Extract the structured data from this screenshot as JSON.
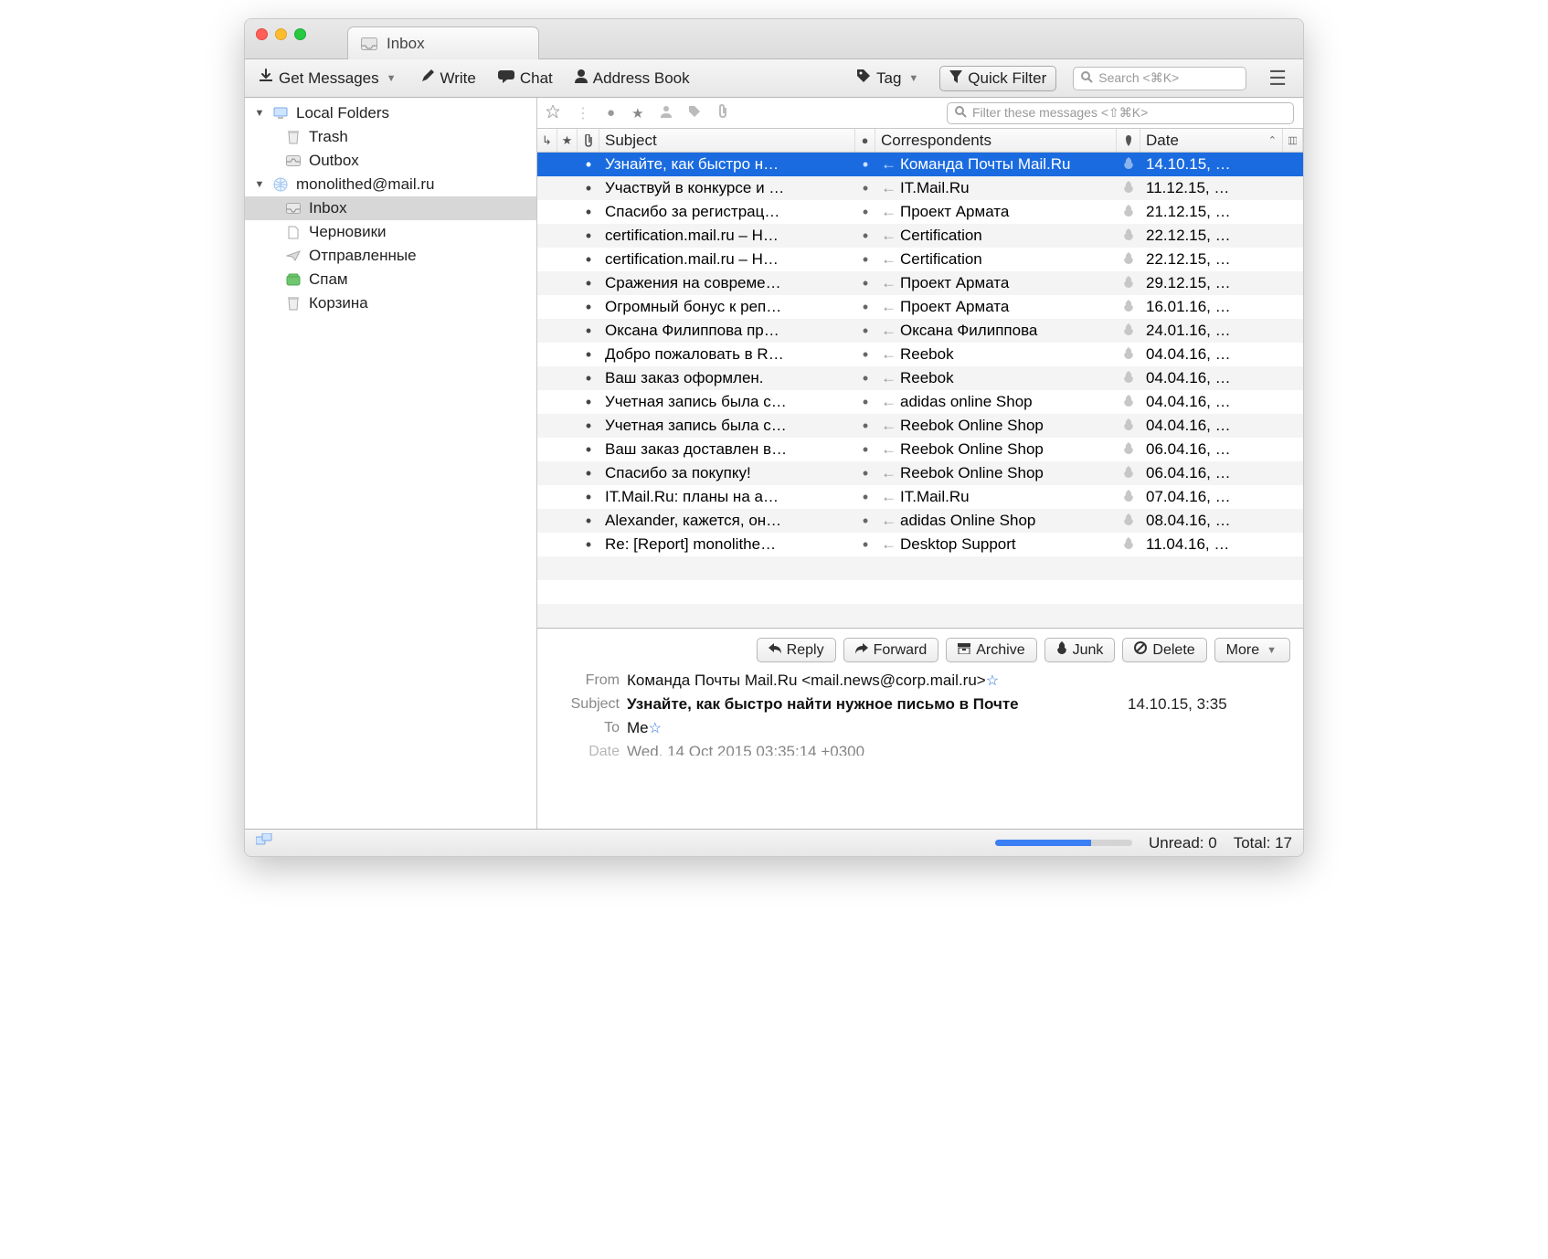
{
  "tab": {
    "title": "Inbox"
  },
  "toolbar": {
    "get_messages": "Get Messages",
    "write": "Write",
    "chat": "Chat",
    "address_book": "Address Book",
    "tag": "Tag",
    "quick_filter": "Quick Filter",
    "search_placeholder": "Search <⌘K>"
  },
  "sidebar": {
    "local": {
      "label": "Local Folders",
      "trash": "Trash",
      "outbox": "Outbox"
    },
    "account": {
      "email": "monolithed@mail.ru",
      "inbox": "Inbox",
      "drafts": "Черновики",
      "sent": "Отправленные",
      "spam": "Спам",
      "trash": "Корзина"
    }
  },
  "filter": {
    "placeholder": "Filter these messages <⇧⌘K>"
  },
  "columns": {
    "subject": "Subject",
    "correspondents": "Correspondents",
    "date": "Date"
  },
  "messages": [
    {
      "subject": "Узнайте, как быстро н…",
      "from": "Команда Почты Mail.Ru",
      "date": "14.10.15, …",
      "selected": true
    },
    {
      "subject": "Участвуй в конкурсе и …",
      "from": "IT.Mail.Ru",
      "date": "11.12.15, …"
    },
    {
      "subject": "Спасибо за регистрац…",
      "from": "Проект Армата",
      "date": "21.12.15, …"
    },
    {
      "subject": "certification.mail.ru – Н…",
      "from": "Certification",
      "date": "22.12.15, …"
    },
    {
      "subject": "certification.mail.ru – Н…",
      "from": "Certification",
      "date": "22.12.15, …"
    },
    {
      "subject": "Сражения на совреме…",
      "from": "Проект Армата",
      "date": "29.12.15, …"
    },
    {
      "subject": "Огромный бонус к реп…",
      "from": "Проект Армата",
      "date": "16.01.16, …"
    },
    {
      "subject": "Оксана Филиппова пр…",
      "from": "Оксана Филиппова",
      "date": "24.01.16, …"
    },
    {
      "subject": "Добро пожаловать в R…",
      "from": "Reebok",
      "date": "04.04.16, …"
    },
    {
      "subject": "Ваш заказ оформлен.",
      "from": "Reebok",
      "date": "04.04.16, …"
    },
    {
      "subject": "Учетная запись была с…",
      "from": "adidas online Shop",
      "date": "04.04.16, …"
    },
    {
      "subject": "Учетная запись была с…",
      "from": "Reebok Online Shop",
      "date": "04.04.16, …"
    },
    {
      "subject": "Ваш заказ доставлен в…",
      "from": "Reebok Online Shop",
      "date": "06.04.16, …"
    },
    {
      "subject": "Спасибо за покупку!",
      "from": "Reebok Online Shop",
      "date": "06.04.16, …"
    },
    {
      "subject": "IT.Mail.Ru: планы на а…",
      "from": "IT.Mail.Ru",
      "date": "07.04.16, …"
    },
    {
      "subject": "Alexander, кажется, он…",
      "from": "adidas Online Shop",
      "date": "08.04.16, …"
    },
    {
      "subject": "Re: [Report] monolithe…",
      "from": "Desktop Support",
      "date": "11.04.16, …"
    }
  ],
  "preview": {
    "buttons": {
      "reply": "Reply",
      "forward": "Forward",
      "archive": "Archive",
      "junk": "Junk",
      "delete": "Delete",
      "more": "More"
    },
    "from_label": "From",
    "from_value": "Команда Почты Mail.Ru <mail.news@corp.mail.ru>",
    "subject_label": "Subject",
    "subject_value": "Узнайте, как быстро найти нужное письмо в Почте",
    "to_label": "To",
    "to_value": "Me",
    "date_label": "Date",
    "date_inline": "14.10.15, 3:35",
    "date_full": "Wed, 14 Oct 2015 03:35:14 +0300"
  },
  "status": {
    "unread_label": "Unread:",
    "unread_value": "0",
    "total_label": "Total:",
    "total_value": "17"
  }
}
